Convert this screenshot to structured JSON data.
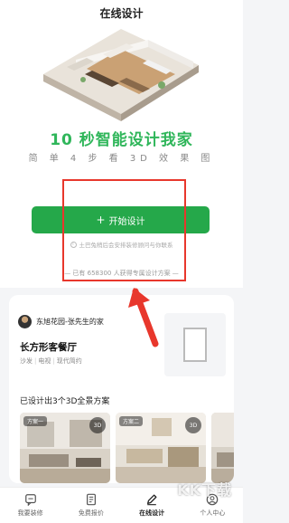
{
  "header": {
    "title": "在线设计"
  },
  "hero": {
    "headline": "10 秒智能设计我家",
    "subhead": "简 单 4 步 看 3D 效 果 图"
  },
  "cta": {
    "label": "开始设计",
    "notice": "土巴兔稍后会安排装修顾问与你联系",
    "count_text": "— 已有 658300 人获得专属设计方案 —"
  },
  "card": {
    "owner": "东旭花园-张先生的家",
    "room_name": "长方形客餐厅",
    "tags": [
      "沙发",
      "电视",
      "现代简约"
    ],
    "cases_title": "已设计出3个3D全景方案",
    "cases": [
      {
        "tag": "方案一",
        "badge": "3D"
      },
      {
        "tag": "方案二",
        "badge": "3D"
      },
      {
        "tag": "",
        "badge": ""
      }
    ]
  },
  "tabbar": {
    "items": [
      {
        "label": "我要装修"
      },
      {
        "label": "免费报价"
      },
      {
        "label": "在线设计"
      },
      {
        "label": "个人中心"
      }
    ],
    "active": "在线设计"
  },
  "watermark": "KK下载",
  "colors": {
    "accent_green": "#25a84a",
    "headline_green": "#2fb65a",
    "highlight_red": "#e8372c"
  }
}
